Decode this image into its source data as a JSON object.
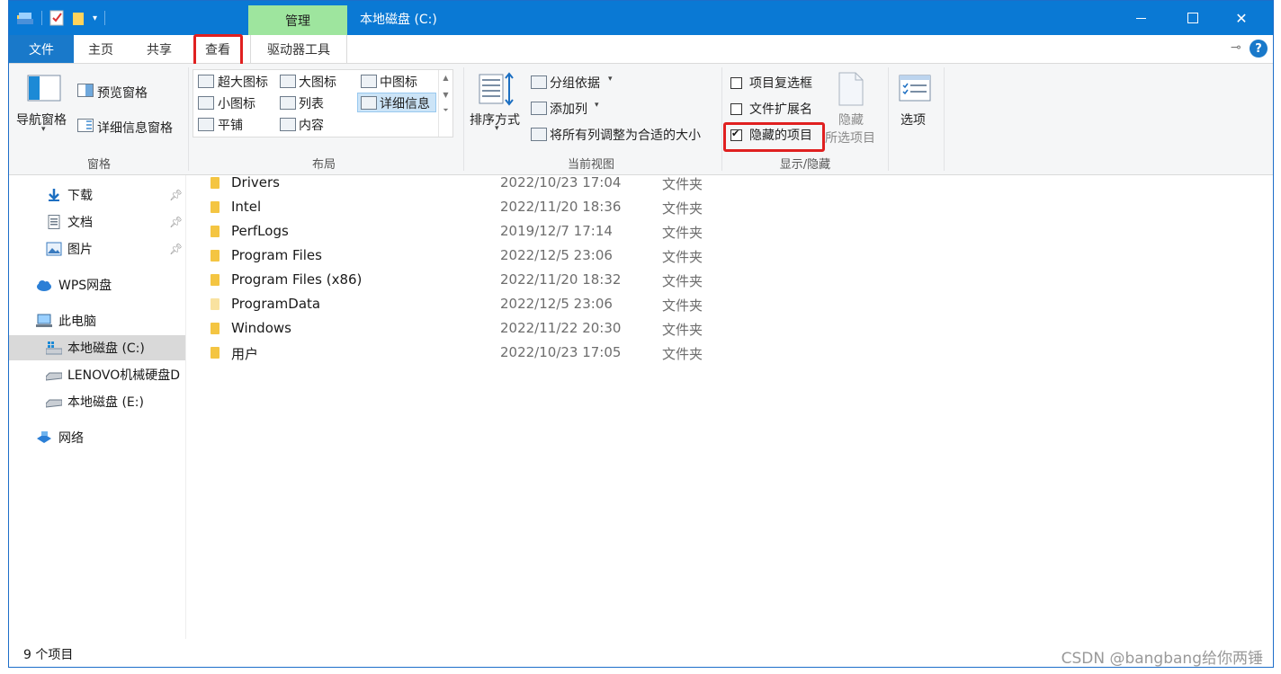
{
  "window": {
    "title": "本地磁盘 (C:)",
    "context_tab": "管理"
  },
  "tabs": {
    "file": "文件",
    "home": "主页",
    "share": "共享",
    "view": "查看",
    "drive_tools": "驱动器工具"
  },
  "ribbon": {
    "panes": {
      "nav_pane": "导航窗格",
      "preview_pane": "预览窗格",
      "details_pane": "详细信息窗格",
      "group_label": "窗格"
    },
    "layout": {
      "items": [
        "超大图标",
        "大图标",
        "中图标",
        "小图标",
        "列表",
        "详细信息",
        "平铺",
        "内容"
      ],
      "selected": "详细信息",
      "group_label": "布局"
    },
    "current_view": {
      "sort_by": "排序方式",
      "group_by": "分组依据",
      "add_column": "添加列",
      "fit_columns": "将所有列调整为合适的大小",
      "group_label": "当前视图"
    },
    "show_hide": {
      "item_checkboxes": "项目复选框",
      "file_extensions": "文件扩展名",
      "hidden_items": "隐藏的项目",
      "hidden_items_checked": true,
      "hide_selected_line1": "隐藏",
      "hide_selected_line2": "所选项目",
      "group_label": "显示/隐藏"
    },
    "options": "选项"
  },
  "nav": {
    "items": [
      {
        "label": "下载",
        "icon": "download-icon",
        "pinned": true
      },
      {
        "label": "文档",
        "icon": "document-icon",
        "pinned": true
      },
      {
        "label": "图片",
        "icon": "picture-icon",
        "pinned": true
      },
      {
        "label": "WPS网盘",
        "icon": "cloud-icon"
      },
      {
        "label": "此电脑",
        "icon": "computer-icon"
      },
      {
        "label": "本地磁盘 (C:)",
        "icon": "drive-icon",
        "selected": true
      },
      {
        "label": "LENOVO机械硬盘D",
        "icon": "drive-icon"
      },
      {
        "label": "本地磁盘 (E:)",
        "icon": "drive-icon"
      },
      {
        "label": "网络",
        "icon": "network-icon"
      }
    ]
  },
  "files": [
    {
      "name": "Drivers",
      "date": "2022/10/23 17:04",
      "type": "文件夹"
    },
    {
      "name": "Intel",
      "date": "2022/11/20 18:36",
      "type": "文件夹"
    },
    {
      "name": "PerfLogs",
      "date": "2019/12/7 17:14",
      "type": "文件夹"
    },
    {
      "name": "Program Files",
      "date": "2022/12/5 23:06",
      "type": "文件夹"
    },
    {
      "name": "Program Files (x86)",
      "date": "2022/11/20 18:32",
      "type": "文件夹"
    },
    {
      "name": "ProgramData",
      "date": "2022/12/5 23:06",
      "type": "文件夹",
      "hidden": true
    },
    {
      "name": "Windows",
      "date": "2022/11/22 20:30",
      "type": "文件夹"
    },
    {
      "name": "用户",
      "date": "2022/10/23 17:05",
      "type": "文件夹"
    }
  ],
  "status": {
    "count": "9 个项目"
  },
  "watermark": "CSDN @bangbang给你两锤",
  "colors": {
    "titlebar": "#0a79d4",
    "manage_tab": "#9ee59e",
    "highlight_box": "#e02020",
    "selection": "#cce4f7"
  }
}
